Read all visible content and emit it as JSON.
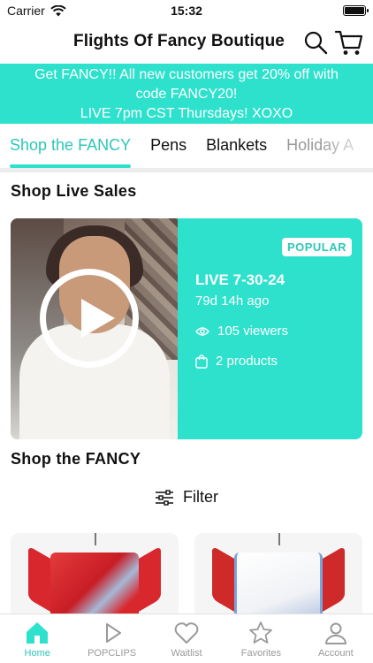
{
  "status_bar": {
    "carrier": "Carrier",
    "time": "15:32"
  },
  "header": {
    "title": "Flights Of Fancy Boutique",
    "search_icon": "search-icon",
    "cart_icon": "cart-icon"
  },
  "promo": {
    "line1": "Get FANCY!! All new customers get 20% off with",
    "line2": "code FANCY20!",
    "line3": "LIVE 7pm CST Thursdays! XOXO"
  },
  "tabs": [
    "Shop the FANCY",
    "Pens",
    "Blankets",
    "Holiday A"
  ],
  "live_section": {
    "title": "Shop Live Sales",
    "card": {
      "badge": "POPULAR",
      "title": "LIVE 7-30-24",
      "ago": "79d 14h ago",
      "viewers": "105 viewers",
      "products": "2 products"
    }
  },
  "shop_section": {
    "title": "Shop the FANCY",
    "filter_label": "Filter"
  },
  "bottom_nav": [
    "Home",
    "POPCLIPS",
    "Waitlist",
    "Favorites",
    "Account"
  ],
  "colors": {
    "accent": "#2ee1cc",
    "accent_text": "#2ec7b8"
  }
}
